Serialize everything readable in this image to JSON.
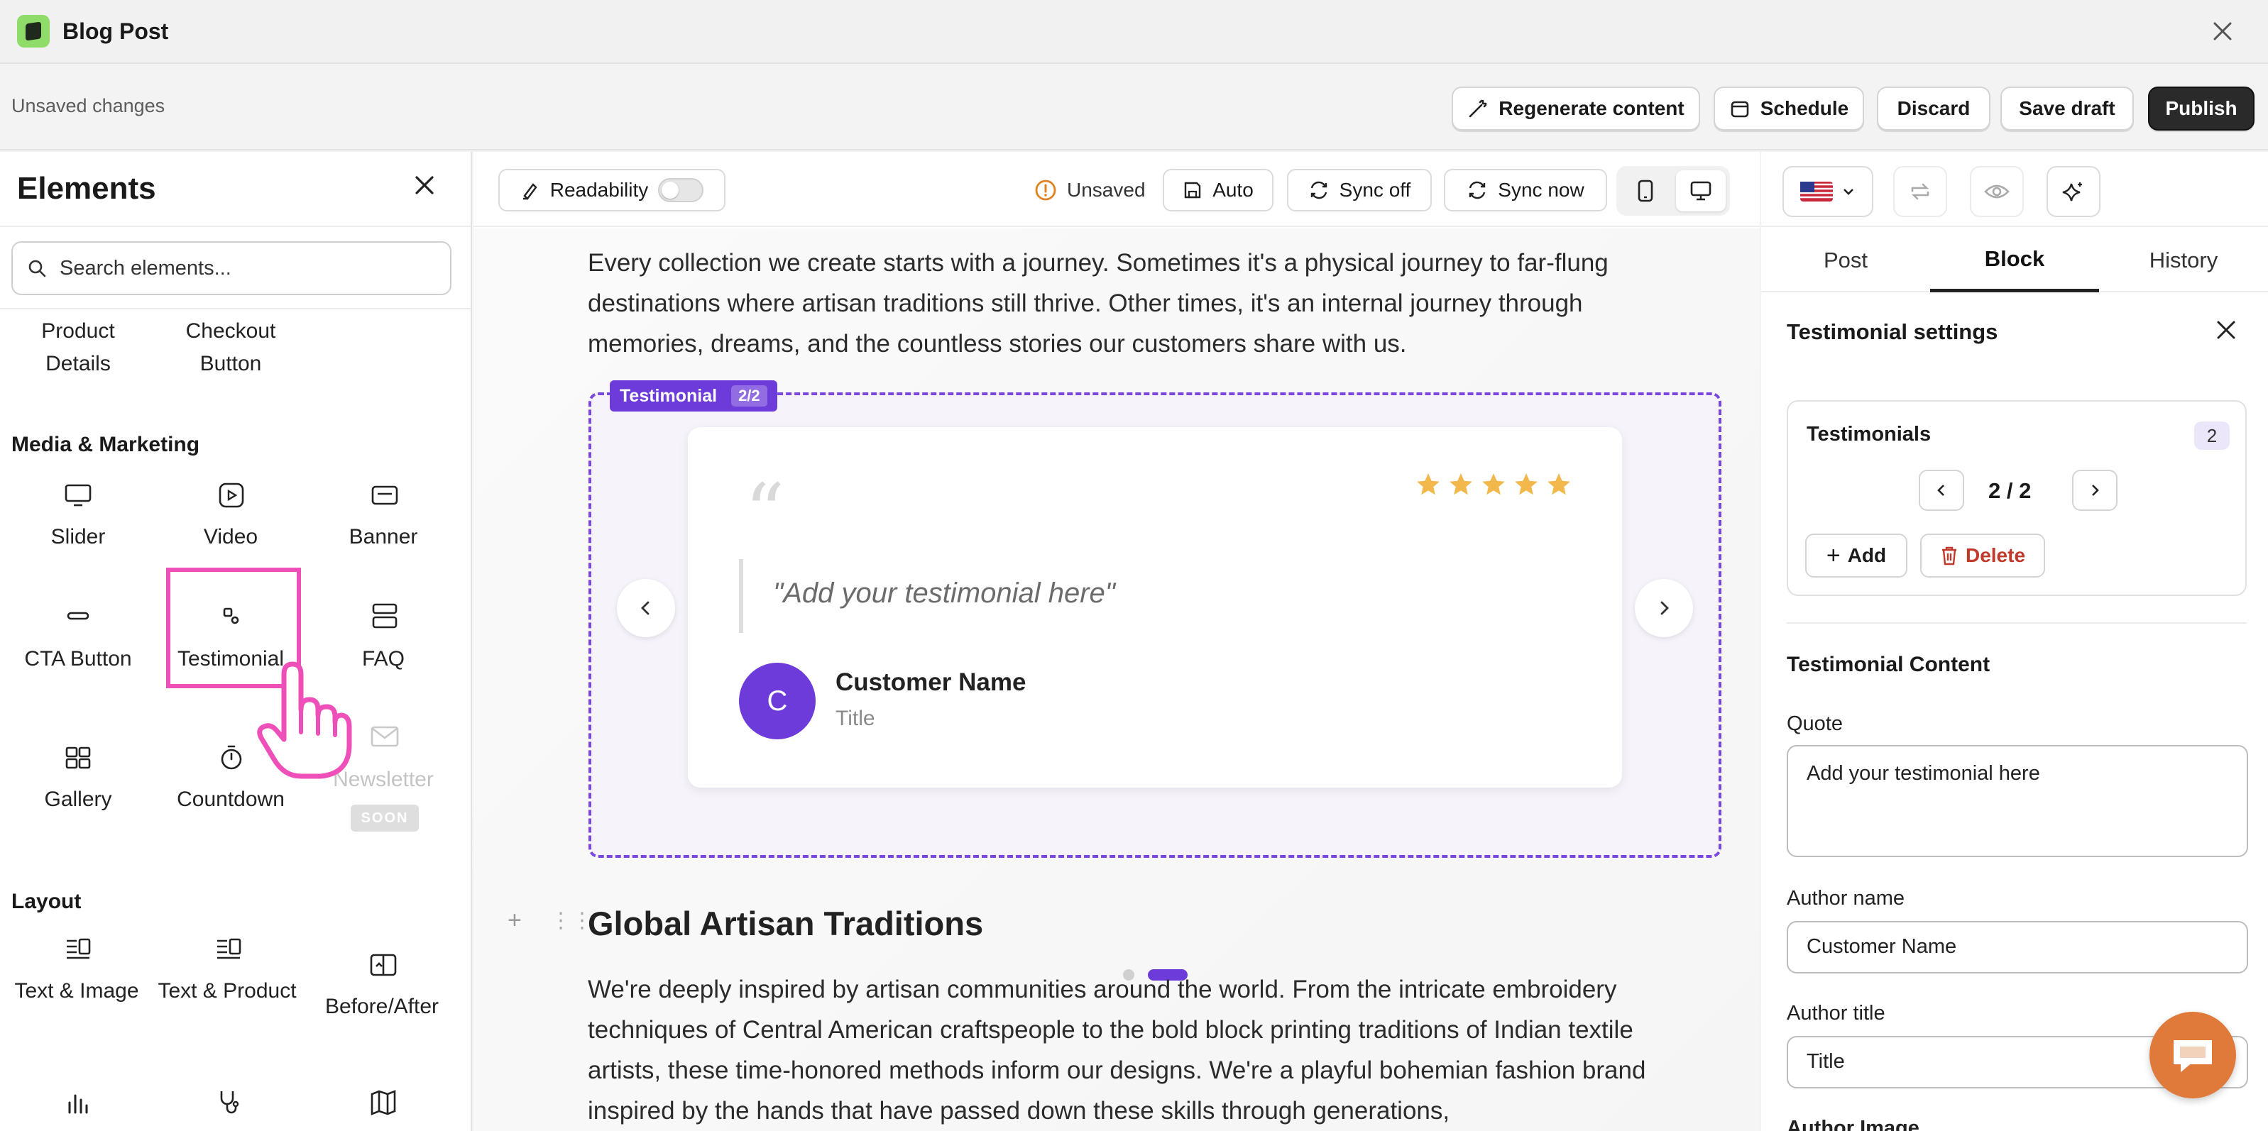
{
  "window": {
    "title": "Blog Post"
  },
  "actionbar": {
    "status": "Unsaved changes",
    "regenerate": "Regenerate content",
    "schedule": "Schedule",
    "discard": "Discard",
    "save_draft": "Save draft",
    "publish": "Publish"
  },
  "elements_panel": {
    "title": "Elements",
    "search_placeholder": "Search elements...",
    "top_items": [
      "Product Details",
      "Checkout Button"
    ],
    "media_title": "Media & Marketing",
    "media_items": [
      "Slider",
      "Video",
      "Banner",
      "CTA Button",
      "Testimonial",
      "FAQ",
      "Gallery",
      "Countdown",
      "Newsletter"
    ],
    "soon_badge": "SOON",
    "layout_title": "Layout",
    "layout_items": [
      "Text & Image",
      "Text & Product",
      "Before/After"
    ]
  },
  "center_toolbar": {
    "readability": "Readability",
    "unsaved": "Unsaved",
    "auto": "Auto",
    "sync_off": "Sync off",
    "sync_now": "Sync now"
  },
  "content": {
    "para1": "Every collection we create starts with a journey. Sometimes it's a physical journey to far-flung destinations where artisan traditions still thrive. Other times, it's an internal journey through memories, dreams, and the countless stories our customers share with us.",
    "testimonial_tag": "Testimonial",
    "testimonial_count": "2/2",
    "quote": "\"Add your testimonial here\"",
    "avatar_initial": "C",
    "customer_name": "Customer Name",
    "customer_title": "Title",
    "rating": 5,
    "heading": "Global Artisan Traditions",
    "para2": "We're deeply inspired by artisan communities around the world. From the intricate embroidery techniques of Central American craftspeople to the bold block printing traditions of Indian textile artists, these time-honored methods inform our designs. We're a playful bohemian fashion brand inspired by the hands that have passed down these skills through generations,"
  },
  "right_panel": {
    "tabs": [
      "Post",
      "Block",
      "History"
    ],
    "settings_title": "Testimonial settings",
    "testimonials_label": "Testimonials",
    "testimonials_count": "2",
    "pager": "2 / 2",
    "add": "Add",
    "delete": "Delete",
    "content_title": "Testimonial Content",
    "quote_label": "Quote",
    "quote_value": "Add your testimonial here",
    "author_name_label": "Author name",
    "author_name_value": "Customer Name",
    "author_title_label": "Author title",
    "author_title_value": "Title",
    "author_image_label": "Author Image"
  },
  "colors": {
    "accent": "#6d3bd9",
    "highlight": "#ef4fb8",
    "star": "#f2b84b",
    "delete": "#c0392b",
    "chat": "#e07a3a"
  }
}
